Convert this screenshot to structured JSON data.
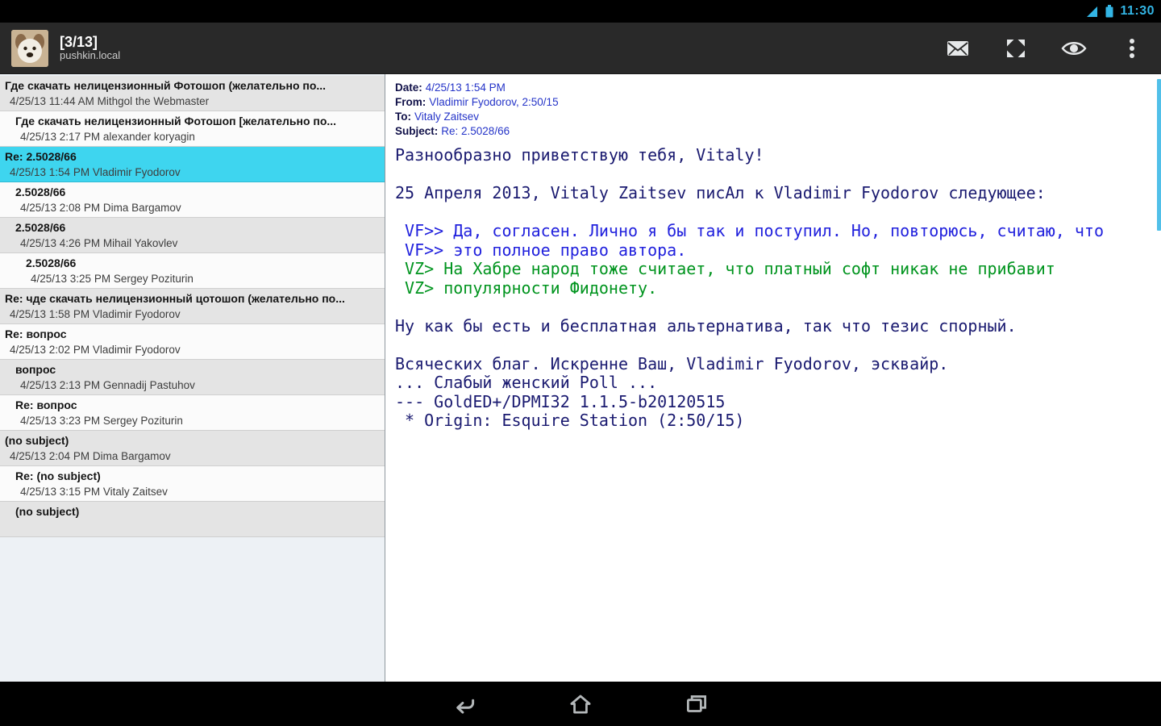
{
  "colors": {
    "accent_blue": "#33b5e5",
    "selected_item": "#3ed5ef",
    "body_navy": "#1a1a70",
    "quote_blue": "#2121dd",
    "quote_green": "#00941e",
    "header_label": "#101048",
    "header_value": "#2534c8"
  },
  "status_bar": {
    "time": "11:30",
    "icons": [
      "signal-icon",
      "battery-icon"
    ]
  },
  "action_bar": {
    "title": "[3/13]",
    "subtitle": "pushkin.local",
    "icons": [
      "compose-mail-icon",
      "fullscreen-icon",
      "mark-read-eye-icon",
      "overflow-menu-icon"
    ]
  },
  "thread_list": {
    "items": [
      {
        "subject": "Где скачать нелицензионный Фотошоп (желательно по...",
        "meta": "4/25/13 11:44 AM Mithgol the Webmaster",
        "indent": 0,
        "selected": false
      },
      {
        "subject": "Где скачать нелицензионный Фотошоп [желательно по...",
        "meta": "4/25/13 2:17 PM alexander koryagin",
        "indent": 1,
        "selected": false
      },
      {
        "subject": "Re: 2.5028/66",
        "meta": "4/25/13 1:54 PM Vladimir Fyodorov",
        "indent": 0,
        "selected": true
      },
      {
        "subject": "2.5028/66",
        "meta": "4/25/13 2:08 PM Dima Bargamov",
        "indent": 1,
        "selected": false
      },
      {
        "subject": "2.5028/66",
        "meta": "4/25/13 4:26 PM Mihail Yakovlev",
        "indent": 1,
        "selected": false
      },
      {
        "subject": "2.5028/66",
        "meta": "4/25/13 3:25 PM Sergey Poziturin",
        "indent": 2,
        "selected": false
      },
      {
        "subject": "Re: чде скачать нелицензионный цотошоп (желательно по...",
        "meta": "4/25/13 1:58 PM Vladimir Fyodorov",
        "indent": 0,
        "selected": false
      },
      {
        "subject": "Re: вопрос",
        "meta": "4/25/13 2:02 PM Vladimir Fyodorov",
        "indent": 0,
        "selected": false
      },
      {
        "subject": "вопрос",
        "meta": "4/25/13 2:13 PM Gennadij Pastuhov",
        "indent": 1,
        "selected": false
      },
      {
        "subject": "Re: вопрос",
        "meta": "4/25/13 3:23 PM Sergey Poziturin",
        "indent": 1,
        "selected": false
      },
      {
        "subject": "(no subject)",
        "meta": "4/25/13 2:04 PM Dima Bargamov",
        "indent": 0,
        "selected": false
      },
      {
        "subject": "Re: (no subject)",
        "meta": "4/25/13 3:15 PM Vitaly Zaitsev",
        "indent": 1,
        "selected": false
      },
      {
        "subject": "(no subject)",
        "meta": "",
        "indent": 1,
        "selected": false
      }
    ]
  },
  "message": {
    "header": [
      {
        "label": "Date:",
        "value": "4/25/13 1:54 PM"
      },
      {
        "label": "From:",
        "value": "Vladimir Fyodorov, 2:50/15"
      },
      {
        "label": "To:",
        "value": "Vitaly Zaitsev"
      },
      {
        "label": "Subject:",
        "value": "Re: 2.5028/66"
      }
    ],
    "body": [
      {
        "style": "normal",
        "text": "Разнообразно приветствую тебя, Vitaly!"
      },
      {
        "style": "normal",
        "text": ""
      },
      {
        "style": "normal",
        "text": "25 Апреля 2013, Vitaly Zaitsev писАл к Vladimir Fyodorov следующее:"
      },
      {
        "style": "normal",
        "text": ""
      },
      {
        "style": "quote2",
        "text": " VF>> Да, согласен. Лично я бы так и поступил. Но, повторюсь, считаю, что"
      },
      {
        "style": "quote2",
        "text": " VF>> это полное право автора."
      },
      {
        "style": "quote1",
        "text": " VZ> На Хабре народ тоже считает, что платный софт никак не прибавит"
      },
      {
        "style": "quote1",
        "text": " VZ> популярности Фидонету."
      },
      {
        "style": "normal",
        "text": ""
      },
      {
        "style": "normal",
        "text": "Ну как бы есть и бесплатная альтернатива, так что тезис спорный."
      },
      {
        "style": "normal",
        "text": ""
      },
      {
        "style": "normal",
        "text": "Всяческих благ. Искренне Ваш, Vladimir Fyodorov, эсквайр."
      },
      {
        "style": "normal",
        "text": "... Слабый женский Poll ..."
      },
      {
        "style": "normal",
        "text": "--- GoldED+/DPMI32 1.1.5-b20120515"
      },
      {
        "style": "normal",
        "text": " * Origin: Esquire Station (2:50/15)"
      }
    ]
  },
  "nav_bar": {
    "icons": [
      "back-icon",
      "home-icon",
      "recents-icon"
    ]
  }
}
